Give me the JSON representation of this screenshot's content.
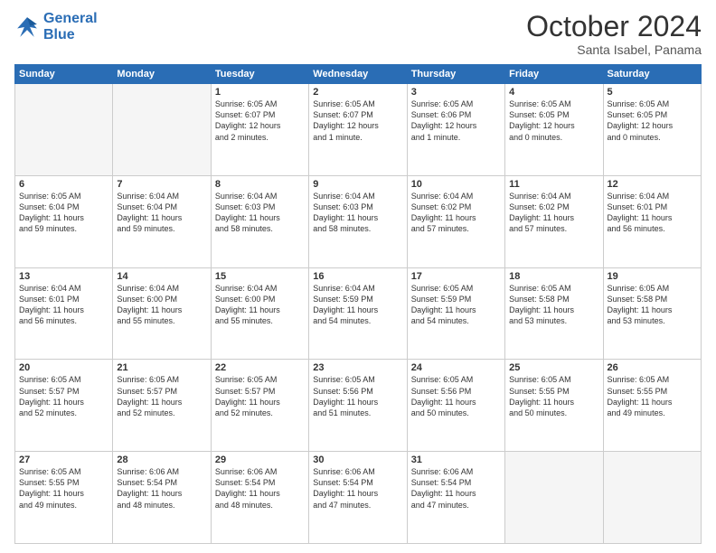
{
  "logo": {
    "line1": "General",
    "line2": "Blue"
  },
  "title": "October 2024",
  "subtitle": "Santa Isabel, Panama",
  "days_of_week": [
    "Sunday",
    "Monday",
    "Tuesday",
    "Wednesday",
    "Thursday",
    "Friday",
    "Saturday"
  ],
  "weeks": [
    [
      {
        "day": "",
        "info": ""
      },
      {
        "day": "",
        "info": ""
      },
      {
        "day": "1",
        "info": "Sunrise: 6:05 AM\nSunset: 6:07 PM\nDaylight: 12 hours\nand 2 minutes."
      },
      {
        "day": "2",
        "info": "Sunrise: 6:05 AM\nSunset: 6:07 PM\nDaylight: 12 hours\nand 1 minute."
      },
      {
        "day": "3",
        "info": "Sunrise: 6:05 AM\nSunset: 6:06 PM\nDaylight: 12 hours\nand 1 minute."
      },
      {
        "day": "4",
        "info": "Sunrise: 6:05 AM\nSunset: 6:05 PM\nDaylight: 12 hours\nand 0 minutes."
      },
      {
        "day": "5",
        "info": "Sunrise: 6:05 AM\nSunset: 6:05 PM\nDaylight: 12 hours\nand 0 minutes."
      }
    ],
    [
      {
        "day": "6",
        "info": "Sunrise: 6:05 AM\nSunset: 6:04 PM\nDaylight: 11 hours\nand 59 minutes."
      },
      {
        "day": "7",
        "info": "Sunrise: 6:04 AM\nSunset: 6:04 PM\nDaylight: 11 hours\nand 59 minutes."
      },
      {
        "day": "8",
        "info": "Sunrise: 6:04 AM\nSunset: 6:03 PM\nDaylight: 11 hours\nand 58 minutes."
      },
      {
        "day": "9",
        "info": "Sunrise: 6:04 AM\nSunset: 6:03 PM\nDaylight: 11 hours\nand 58 minutes."
      },
      {
        "day": "10",
        "info": "Sunrise: 6:04 AM\nSunset: 6:02 PM\nDaylight: 11 hours\nand 57 minutes."
      },
      {
        "day": "11",
        "info": "Sunrise: 6:04 AM\nSunset: 6:02 PM\nDaylight: 11 hours\nand 57 minutes."
      },
      {
        "day": "12",
        "info": "Sunrise: 6:04 AM\nSunset: 6:01 PM\nDaylight: 11 hours\nand 56 minutes."
      }
    ],
    [
      {
        "day": "13",
        "info": "Sunrise: 6:04 AM\nSunset: 6:01 PM\nDaylight: 11 hours\nand 56 minutes."
      },
      {
        "day": "14",
        "info": "Sunrise: 6:04 AM\nSunset: 6:00 PM\nDaylight: 11 hours\nand 55 minutes."
      },
      {
        "day": "15",
        "info": "Sunrise: 6:04 AM\nSunset: 6:00 PM\nDaylight: 11 hours\nand 55 minutes."
      },
      {
        "day": "16",
        "info": "Sunrise: 6:04 AM\nSunset: 5:59 PM\nDaylight: 11 hours\nand 54 minutes."
      },
      {
        "day": "17",
        "info": "Sunrise: 6:05 AM\nSunset: 5:59 PM\nDaylight: 11 hours\nand 54 minutes."
      },
      {
        "day": "18",
        "info": "Sunrise: 6:05 AM\nSunset: 5:58 PM\nDaylight: 11 hours\nand 53 minutes."
      },
      {
        "day": "19",
        "info": "Sunrise: 6:05 AM\nSunset: 5:58 PM\nDaylight: 11 hours\nand 53 minutes."
      }
    ],
    [
      {
        "day": "20",
        "info": "Sunrise: 6:05 AM\nSunset: 5:57 PM\nDaylight: 11 hours\nand 52 minutes."
      },
      {
        "day": "21",
        "info": "Sunrise: 6:05 AM\nSunset: 5:57 PM\nDaylight: 11 hours\nand 52 minutes."
      },
      {
        "day": "22",
        "info": "Sunrise: 6:05 AM\nSunset: 5:57 PM\nDaylight: 11 hours\nand 52 minutes."
      },
      {
        "day": "23",
        "info": "Sunrise: 6:05 AM\nSunset: 5:56 PM\nDaylight: 11 hours\nand 51 minutes."
      },
      {
        "day": "24",
        "info": "Sunrise: 6:05 AM\nSunset: 5:56 PM\nDaylight: 11 hours\nand 50 minutes."
      },
      {
        "day": "25",
        "info": "Sunrise: 6:05 AM\nSunset: 5:55 PM\nDaylight: 11 hours\nand 50 minutes."
      },
      {
        "day": "26",
        "info": "Sunrise: 6:05 AM\nSunset: 5:55 PM\nDaylight: 11 hours\nand 49 minutes."
      }
    ],
    [
      {
        "day": "27",
        "info": "Sunrise: 6:05 AM\nSunset: 5:55 PM\nDaylight: 11 hours\nand 49 minutes."
      },
      {
        "day": "28",
        "info": "Sunrise: 6:06 AM\nSunset: 5:54 PM\nDaylight: 11 hours\nand 48 minutes."
      },
      {
        "day": "29",
        "info": "Sunrise: 6:06 AM\nSunset: 5:54 PM\nDaylight: 11 hours\nand 48 minutes."
      },
      {
        "day": "30",
        "info": "Sunrise: 6:06 AM\nSunset: 5:54 PM\nDaylight: 11 hours\nand 47 minutes."
      },
      {
        "day": "31",
        "info": "Sunrise: 6:06 AM\nSunset: 5:54 PM\nDaylight: 11 hours\nand 47 minutes."
      },
      {
        "day": "",
        "info": ""
      },
      {
        "day": "",
        "info": ""
      }
    ]
  ]
}
